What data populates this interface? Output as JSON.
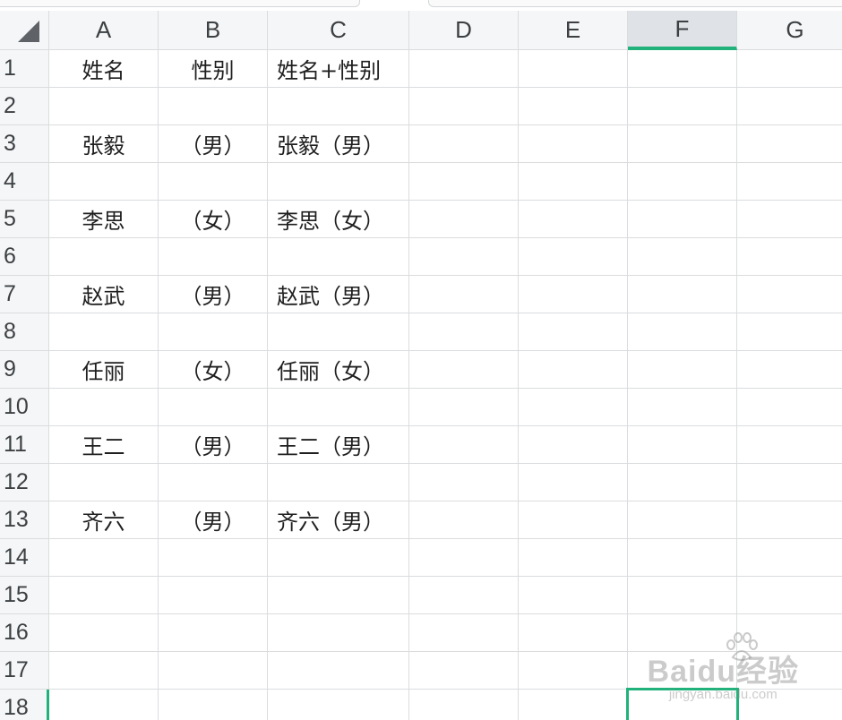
{
  "columns": [
    "A",
    "B",
    "C",
    "D",
    "E",
    "F",
    "G"
  ],
  "selected_column": "F",
  "rows": [
    "1",
    "2",
    "3",
    "4",
    "5",
    "6",
    "7",
    "8",
    "9",
    "10",
    "11",
    "12",
    "13",
    "14",
    "15",
    "16",
    "17",
    "18"
  ],
  "cells": {
    "r1": {
      "a": "姓名",
      "b": "性别",
      "c": "姓名+性别"
    },
    "r3": {
      "a": "张毅",
      "b": "（男）",
      "c": "张毅（男）"
    },
    "r5": {
      "a": "李思",
      "b": "（女）",
      "c": "李思（女）"
    },
    "r7": {
      "a": "赵武",
      "b": "（男）",
      "c": "赵武（男）"
    },
    "r9": {
      "a": "任丽",
      "b": "（女）",
      "c": "任丽（女）"
    },
    "r11": {
      "a": "王二",
      "b": "（男）",
      "c": "王二（男）"
    },
    "r13": {
      "a": "齐六",
      "b": "（男）",
      "c": "齐六（男）"
    }
  },
  "watermark": {
    "brand": "Baidu经验",
    "url": "jingyan.baidu.com"
  },
  "colors": {
    "accent": "#21b27b",
    "grid": "#dadcde",
    "header_bg": "#f5f6f7"
  }
}
